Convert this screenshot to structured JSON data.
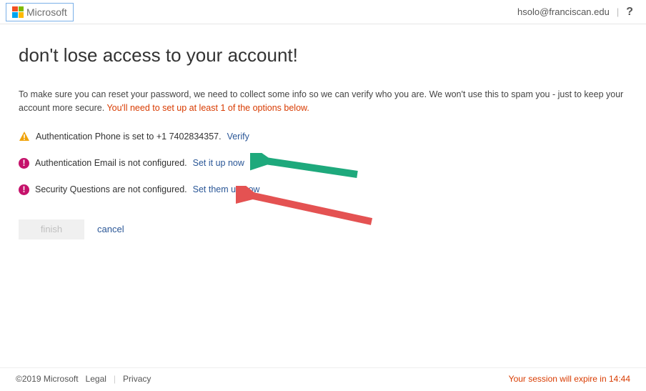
{
  "header": {
    "brand": "Microsoft",
    "user_email": "hsolo@franciscan.edu",
    "help_glyph": "?"
  },
  "page": {
    "title": "don't lose access to your account!",
    "intro_part1": "To make sure you can reset your password, we need to collect some info so we can verify who you are. We won't use this to spam you - just to keep your account more secure. ",
    "intro_warn": "You'll need to set up at least 1 of the options below."
  },
  "options": {
    "phone": {
      "text": "Authentication Phone is set to +1 7402834357. ",
      "link": "Verify"
    },
    "email": {
      "text": "Authentication Email is not configured. ",
      "link": "Set it up now"
    },
    "questions": {
      "text": "Security Questions are not configured. ",
      "link": "Set them up now"
    }
  },
  "actions": {
    "finish": "finish",
    "cancel": "cancel"
  },
  "footer": {
    "copyright": "©2019 Microsoft",
    "legal": "Legal",
    "privacy": "Privacy",
    "session_prefix": "Your session will expire in ",
    "session_time": "14:44"
  }
}
